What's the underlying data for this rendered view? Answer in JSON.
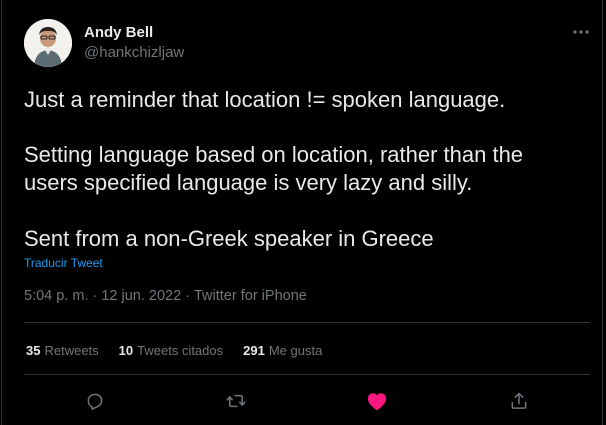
{
  "author": {
    "name": "Andy Bell",
    "handle": "@hankchizljaw"
  },
  "tweet": {
    "paragraphs": [
      "Just a reminder that location != spoken language.",
      "Setting language based on location, rather than the",
      "users specified language is very lazy and silly.",
      "Sent from a non-Greek speaker in Greece"
    ],
    "translate_label": "Traducir Tweet",
    "time": "5:04 p. m.",
    "separator": "·",
    "date": "12 jun. 2022",
    "source": "Twitter for iPhone"
  },
  "stats": {
    "retweets_count": "35",
    "retweets_label": "Retweets",
    "quotes_count": "10",
    "quotes_label": "Tweets citados",
    "likes_count": "291",
    "likes_label": "Me gusta"
  },
  "actions": {
    "reply_icon": "reply-icon",
    "retweet_icon": "retweet-icon",
    "like_icon": "heart-filled-icon",
    "share_icon": "share-icon",
    "like_color": "#f91880",
    "icon_color": "#71767b"
  },
  "colors": {
    "background": "#000000",
    "text": "#e7e9ea",
    "muted": "#71767b",
    "accent": "#1d9bf0",
    "border": "#2f3336"
  }
}
